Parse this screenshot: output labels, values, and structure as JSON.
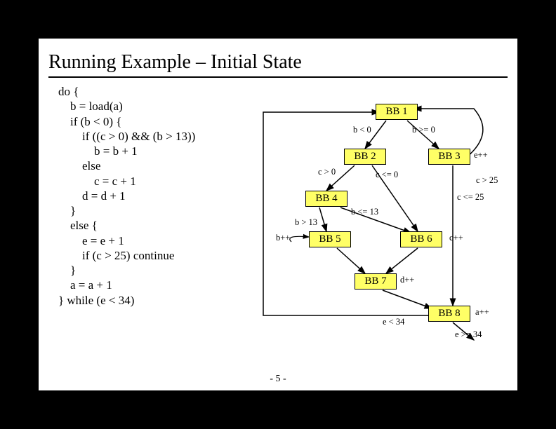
{
  "title": "Running Example – Initial State",
  "code": "do {\n    b = load(a)\n    if (b < 0) {\n        if ((c > 0) && (b > 13))\n            b = b + 1\n        else\n            c = c + 1\n        d = d + 1\n    }\n    else {\n        e = e + 1\n        if (c > 25) continue\n    }\n    a = a + 1\n} while (e < 34)",
  "nodes": {
    "bb1": "BB 1",
    "bb2": "BB 2",
    "bb3": "BB 3",
    "bb4": "BB 4",
    "bb5": "BB 5",
    "bb6": "BB 6",
    "bb7": "BB 7",
    "bb8": "BB 8"
  },
  "edges": {
    "blt0": "b < 0",
    "bge0": "b >= 0",
    "epp": "e++",
    "cgt0": "c > 0",
    "cle0": "c <= 0",
    "cgt25": "c > 25",
    "cle25": "c <= 25",
    "bgt13": "b > 13",
    "ble13": "b <= 13",
    "bpp": "b++",
    "cpp": "c++",
    "dpp": "d++",
    "elt34": "e < 34",
    "ege34": "e >= 34",
    "app": "a++"
  },
  "page": "- 5 -"
}
